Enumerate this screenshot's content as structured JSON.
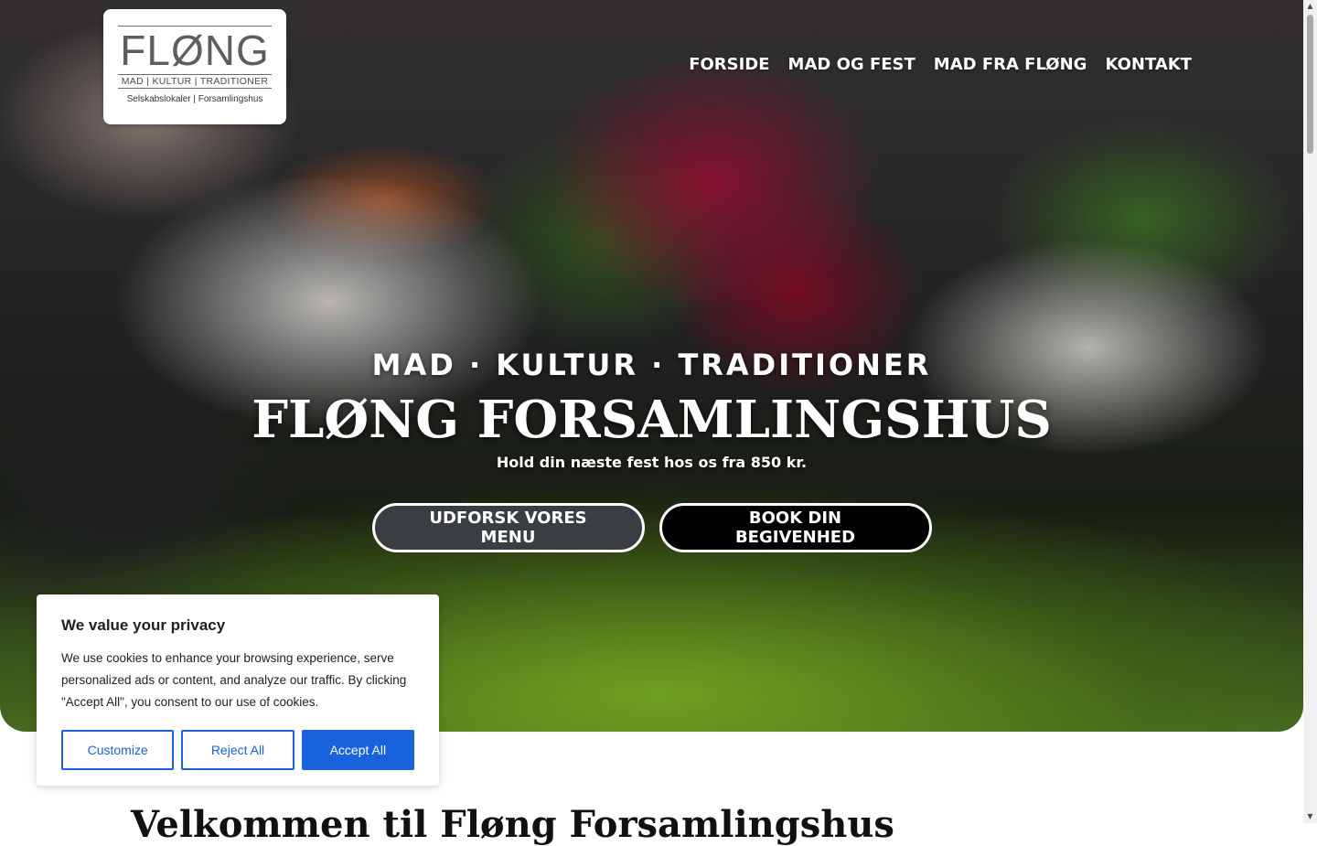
{
  "logo": {
    "wordmark": "FLØNG",
    "sub": "MAD | KULTUR | TRADITIONER",
    "sub2": "Selskabslokaler | Forsamlingshus"
  },
  "nav": {
    "items": [
      {
        "label": "FORSIDE"
      },
      {
        "label": "MAD OG FEST"
      },
      {
        "label": "MAD FRA FLØNG"
      },
      {
        "label": "KONTAKT"
      }
    ]
  },
  "hero": {
    "tagline": "MAD · KULTUR · TRADITIONER",
    "title": "FLØNG FORSAMLINGSHUS",
    "subtitle": "Hold din næste fest hos os fra 850 kr.",
    "button_menu": "UDFORSK VORES MENU",
    "button_book": "BOOK DIN BEGIVENHED"
  },
  "main": {
    "welcome_heading": "Velkommen til Fløng Forsamlingshus"
  },
  "cookie": {
    "title": "We value your privacy",
    "text": "We use cookies to enhance your browsing experience, serve personalized ads or content, and analyze our traffic. By clicking \"Accept All\", you consent to our use of cookies.",
    "customize": "Customize",
    "reject": "Reject All",
    "accept": "Accept All"
  },
  "colors": {
    "accent_blue": "#1863dc",
    "button_dark": "#3a3d42",
    "button_black": "#000000"
  }
}
